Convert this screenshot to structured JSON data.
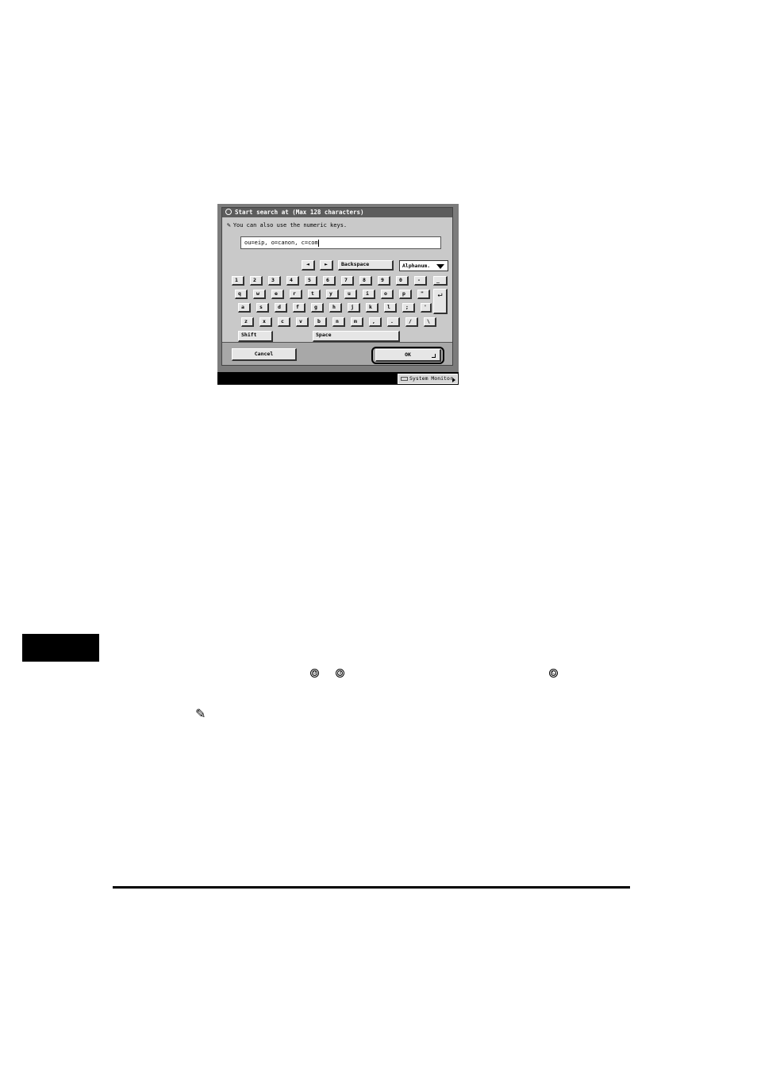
{
  "dialog": {
    "title": "Start search at (Max 128 characters)",
    "hint": "You can also use the numeric keys.",
    "input_value": "ou=eip, o=canon, c=com",
    "nav": {
      "left_arrow": "◄",
      "right_arrow": "►",
      "backspace": "Backspace"
    },
    "mode_select": "Alphanum.",
    "keys": {
      "row1": [
        "1",
        "2",
        "3",
        "4",
        "5",
        "6",
        "7",
        "8",
        "9",
        "0",
        "-",
        "_"
      ],
      "row2": [
        "q",
        "w",
        "e",
        "r",
        "t",
        "y",
        "u",
        "i",
        "o",
        "p",
        "\"",
        "↵"
      ],
      "row3": [
        "a",
        "s",
        "d",
        "f",
        "g",
        "h",
        "j",
        "k",
        "l",
        ";",
        "'"
      ],
      "row4": [
        "z",
        "x",
        "c",
        "v",
        "b",
        "n",
        "m",
        ",",
        ".",
        "/",
        "\\"
      ],
      "shift": "Shift",
      "space": "Space"
    },
    "cancel_label": "Cancel",
    "ok_label": "OK",
    "system_monitor": "System Monitor"
  },
  "page": {
    "key_icons": [
      "0",
      "3",
      "C"
    ],
    "note_icon": "pencil-icon"
  }
}
